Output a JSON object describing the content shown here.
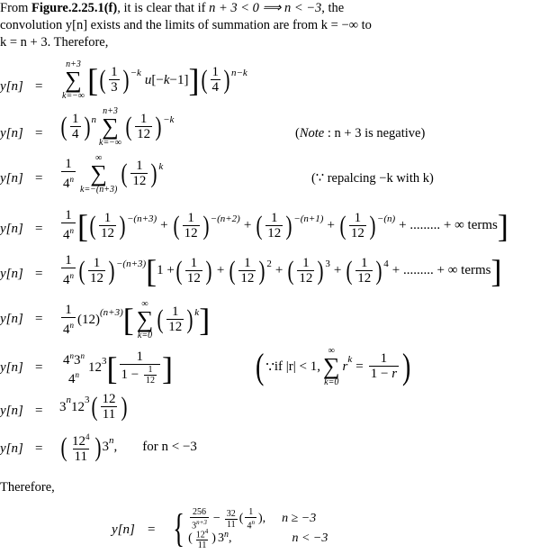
{
  "intro": {
    "line1_a": "From ",
    "figure_ref": "Figure.2.25.1(f)",
    "line1_b": ", it is clear that if ",
    "cond": "n + 3 < 0  ⟹  n < −3",
    "line1_c": ", the",
    "line2": "convolution y[n] exists and the limits of summation are from k = −∞ to",
    "line3": "k = n + 3. Therefore,"
  },
  "lhs": "y[n]",
  "eq_sign": "=",
  "equations": [
    {
      "sum_upper": "n+3",
      "sum_lower": "k=−∞",
      "body": "[ (1/3)^(−k) u[−k−1] ] (1/4)^(n−k)",
      "note": ""
    },
    {
      "prefix": "(1/4)^n",
      "sum_upper": "n+3",
      "sum_lower": "k=−∞",
      "body": "(1/12)^(−k)",
      "note": "(Note : n + 3 is negative)"
    },
    {
      "prefix": "1/4^n",
      "sum_upper": "∞",
      "sum_lower": "k=−(n+3)",
      "body": "(1/12)^k",
      "note": "(∵ repalcing −k with k)"
    },
    {
      "prefix": "1/4^n",
      "body": "[ (1/12)^−(n+3) + (1/12)^−(n+2) + (1/12)^−(n+1) + (1/12)^−(n) + ......... + ∞ terms ]"
    },
    {
      "prefix": "1/4^n (1/12)^−(n+3)",
      "body": "[ 1 + (1/12) + (1/12)^2 + (1/12)^3 + (1/12)^4 + ......... + ∞ terms ]"
    },
    {
      "prefix": "1/4^n (12)^(n+3)",
      "sum_upper": "∞",
      "sum_lower": "k=0",
      "body": "[ Σ (1/12)^k ]"
    },
    {
      "body": "4^n 3^n / 4^n · 12^3 [ 1 / (1 − 1/12) ]",
      "note": "(∵ if |r| < 1, Σ_{k=0}^{∞} r^k = 1/(1 − r))"
    },
    {
      "body": "3^n 12^3 (12/11)"
    },
    {
      "body": "(12^4/11) 3^n,",
      "note": "for n < −3"
    }
  ],
  "labels": {
    "note_text": "Note",
    "note_rest": " : n + 3 is negative)",
    "because": "∵",
    "replacing": " repalcing −k with k)",
    "if_text": " if |r| < 1,",
    "infty_terms": "+ ......... + ∞ terms",
    "for_n": "for n < −3",
    "therefore": "Therefore,"
  },
  "result": {
    "lhs": "y[n]",
    "case1_expr": "256/3^(n+3) − 32/11 (1/4^n),",
    "case1_cond": "n ≥ −3",
    "case2_expr": "(12^4/11) 3^n,",
    "case2_cond": "n < −3"
  }
}
